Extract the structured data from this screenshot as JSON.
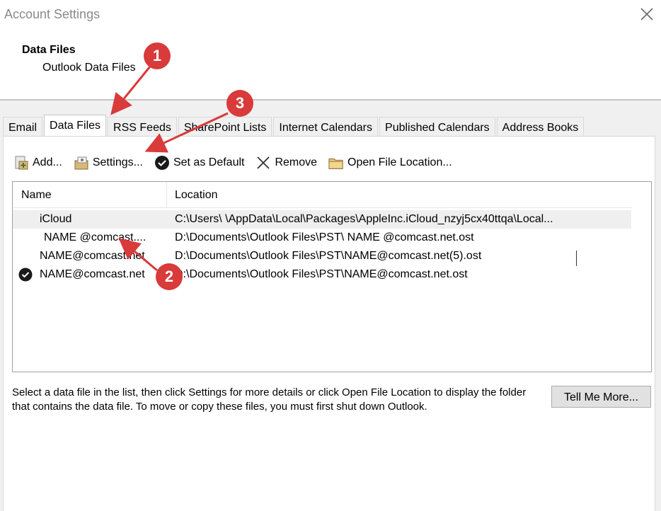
{
  "window": {
    "title": "Account Settings"
  },
  "header": {
    "title": "Data Files",
    "subtitle": "Outlook Data Files"
  },
  "tabs": [
    {
      "label": "Email"
    },
    {
      "label": "Data Files"
    },
    {
      "label": "RSS Feeds"
    },
    {
      "label": "SharePoint Lists"
    },
    {
      "label": "Internet Calendars"
    },
    {
      "label": "Published Calendars"
    },
    {
      "label": "Address Books"
    }
  ],
  "active_tab": "Data Files",
  "toolbar": {
    "add_label": "Add...",
    "settings_label": "Settings...",
    "default_label": "Set as Default",
    "remove_label": "Remove",
    "open_location_label": "Open File Location..."
  },
  "list": {
    "headers": {
      "name": "Name",
      "location": "Location"
    },
    "rows": [
      {
        "name": "iCloud",
        "location": "C:\\Users\\            \\AppData\\Local\\Packages\\AppleInc.iCloud_nzyj5cx40ttqa\\Local..."
      },
      {
        "name": "NAME   @comcast....",
        "location": "D:\\Documents\\Outlook Files\\PST\\ NAME  @comcast.net.ost"
      },
      {
        "name": "NAME@comcast.net",
        "location": "D:\\Documents\\Outlook Files\\PST\\NAME@comcast.net(5).ost"
      },
      {
        "name": "NAME@comcast.net",
        "location": "D:\\Documents\\Outlook Files\\PST\\NAME@comcast.net.ost"
      }
    ],
    "default_row": 4
  },
  "description": "Select a data file in the list, then click Settings for more details or click Open File Location to display the folder that contains the data file. To move or copy these files, you must first shut down Outlook.",
  "tell_me_more_label": "Tell Me More...",
  "annotations": {
    "one": "1",
    "two": "2",
    "three": "3"
  },
  "colors": {
    "annotation": "#d93a3a",
    "selection": "#efefef"
  }
}
